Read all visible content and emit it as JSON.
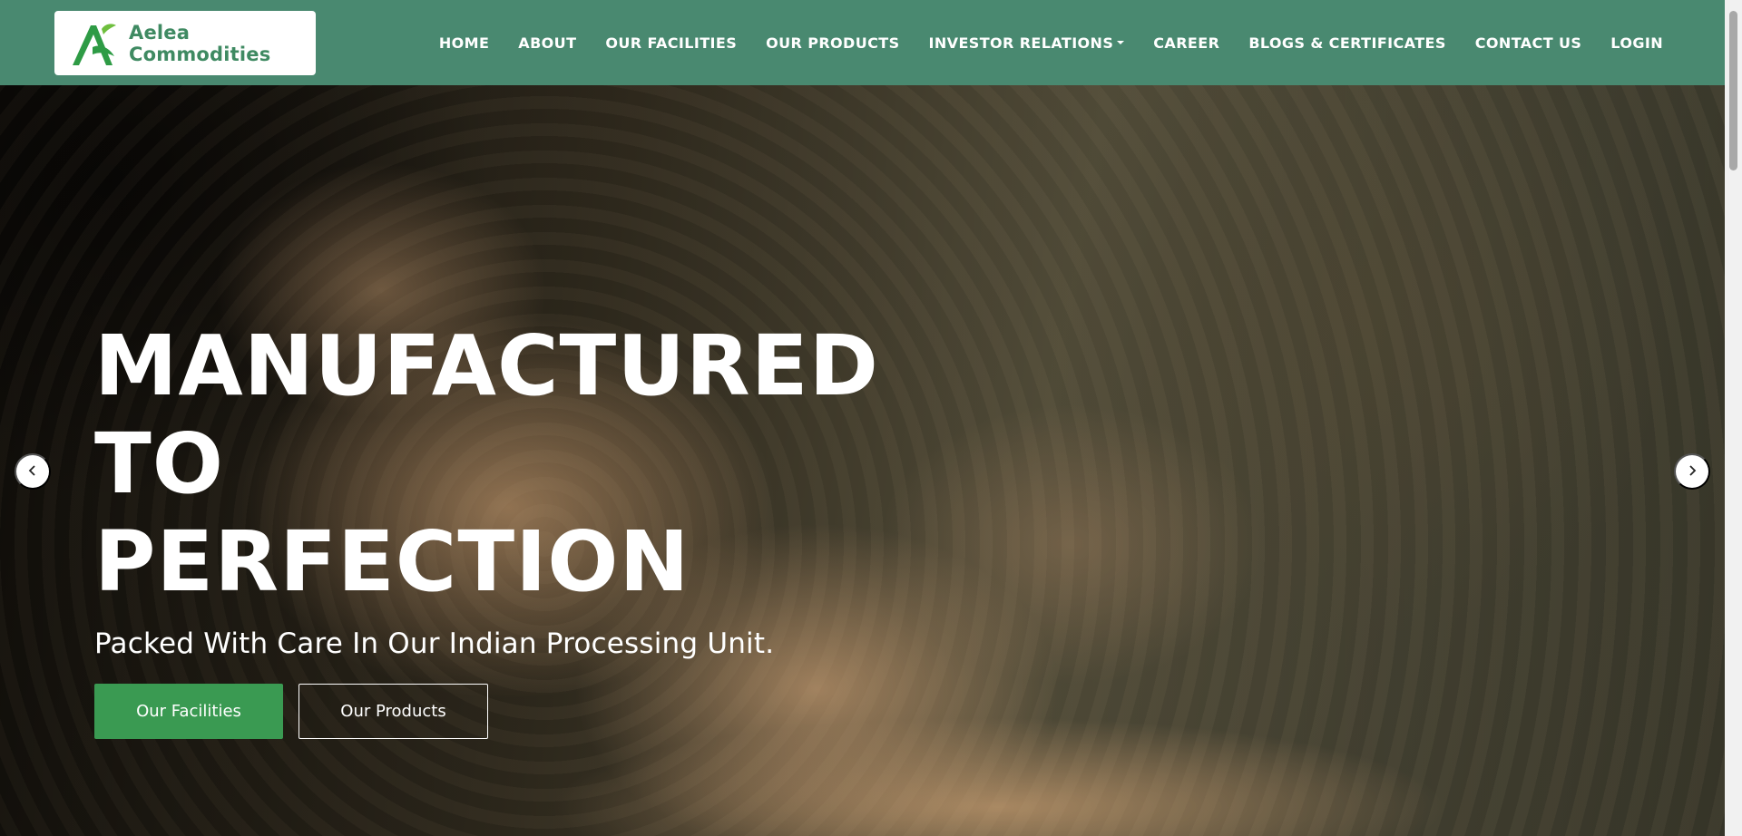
{
  "brand": {
    "name": "Aelea Commodities",
    "logo_icon": "aelea-logo-icon",
    "color": "#3f8a62"
  },
  "nav": {
    "background": "#498970",
    "items": [
      {
        "label": "HOME"
      },
      {
        "label": "ABOUT"
      },
      {
        "label": "OUR FACILITIES"
      },
      {
        "label": "OUR PRODUCTS"
      },
      {
        "label": "INVESTOR RELATIONS",
        "dropdown": true
      },
      {
        "label": "CAREER"
      },
      {
        "label": "BLOGS & CERTIFICATES"
      },
      {
        "label": "CONTACT US"
      },
      {
        "label": "LOGIN"
      }
    ]
  },
  "hero": {
    "title_line1": "MANUFACTURED TO",
    "title_line2": "PERFECTION",
    "subtitle": "Packed With Care In Our Indian Processing Unit.",
    "primary_button": "Our Facilities",
    "secondary_button": "Our Products",
    "primary_color": "#3a9a52"
  },
  "carousel": {
    "prev_icon": "chevron-left-icon",
    "next_icon": "chevron-right-icon"
  }
}
